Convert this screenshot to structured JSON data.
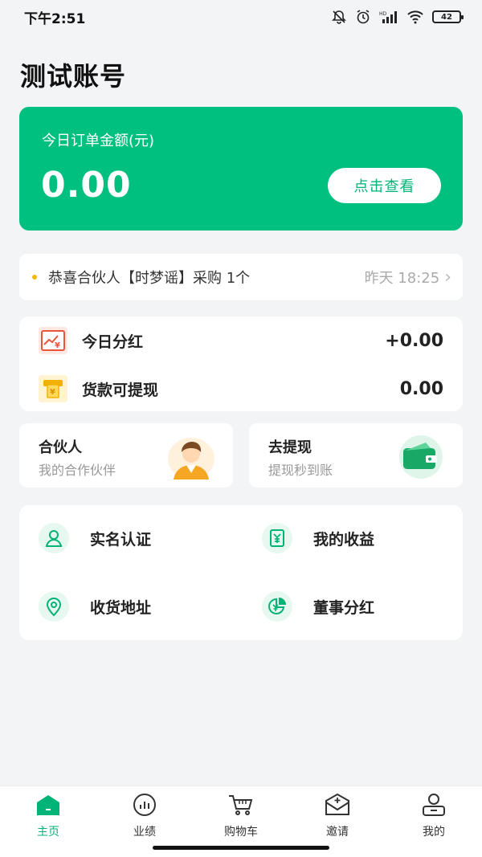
{
  "status_bar": {
    "time": "下午2:51",
    "battery": "42"
  },
  "page": {
    "title": "测试账号"
  },
  "order_card": {
    "label": "今日订单金额(元)",
    "amount": "0.00",
    "button": "点击查看",
    "color": "#00c080"
  },
  "notice": {
    "text": "恭喜合伙人【时梦谣】采购 1个",
    "time": "昨天 18:25"
  },
  "earnings": {
    "items": [
      {
        "label": "今日分红",
        "value": "+0.00",
        "icon": "chart-yen-icon"
      },
      {
        "label": "货款可提现",
        "value": "0.00",
        "icon": "atm-yen-icon"
      }
    ]
  },
  "cards": {
    "partner": {
      "title": "合伙人",
      "subtitle": "我的合作伙伴",
      "icon": "partner-avatar-icon"
    },
    "withdraw": {
      "title": "去提现",
      "subtitle": "提现秒到账",
      "icon": "wallet-icon"
    }
  },
  "menu": {
    "items": [
      {
        "label": "实名认证",
        "icon": "user-verify-icon"
      },
      {
        "label": "我的收益",
        "icon": "income-yen-icon"
      },
      {
        "label": "收货地址",
        "icon": "location-pin-icon"
      },
      {
        "label": "董事分红",
        "icon": "pie-yen-icon"
      }
    ]
  },
  "bottom_nav": {
    "items": [
      {
        "label": "主页",
        "icon": "home-icon",
        "active": true
      },
      {
        "label": "业绩",
        "icon": "bar-chart-icon",
        "active": false
      },
      {
        "label": "购物车",
        "icon": "cart-icon",
        "active": false
      },
      {
        "label": "邀请",
        "icon": "invite-envelope-icon",
        "active": false
      },
      {
        "label": "我的",
        "icon": "profile-icon",
        "active": false
      }
    ],
    "active_color": "#00b377"
  }
}
